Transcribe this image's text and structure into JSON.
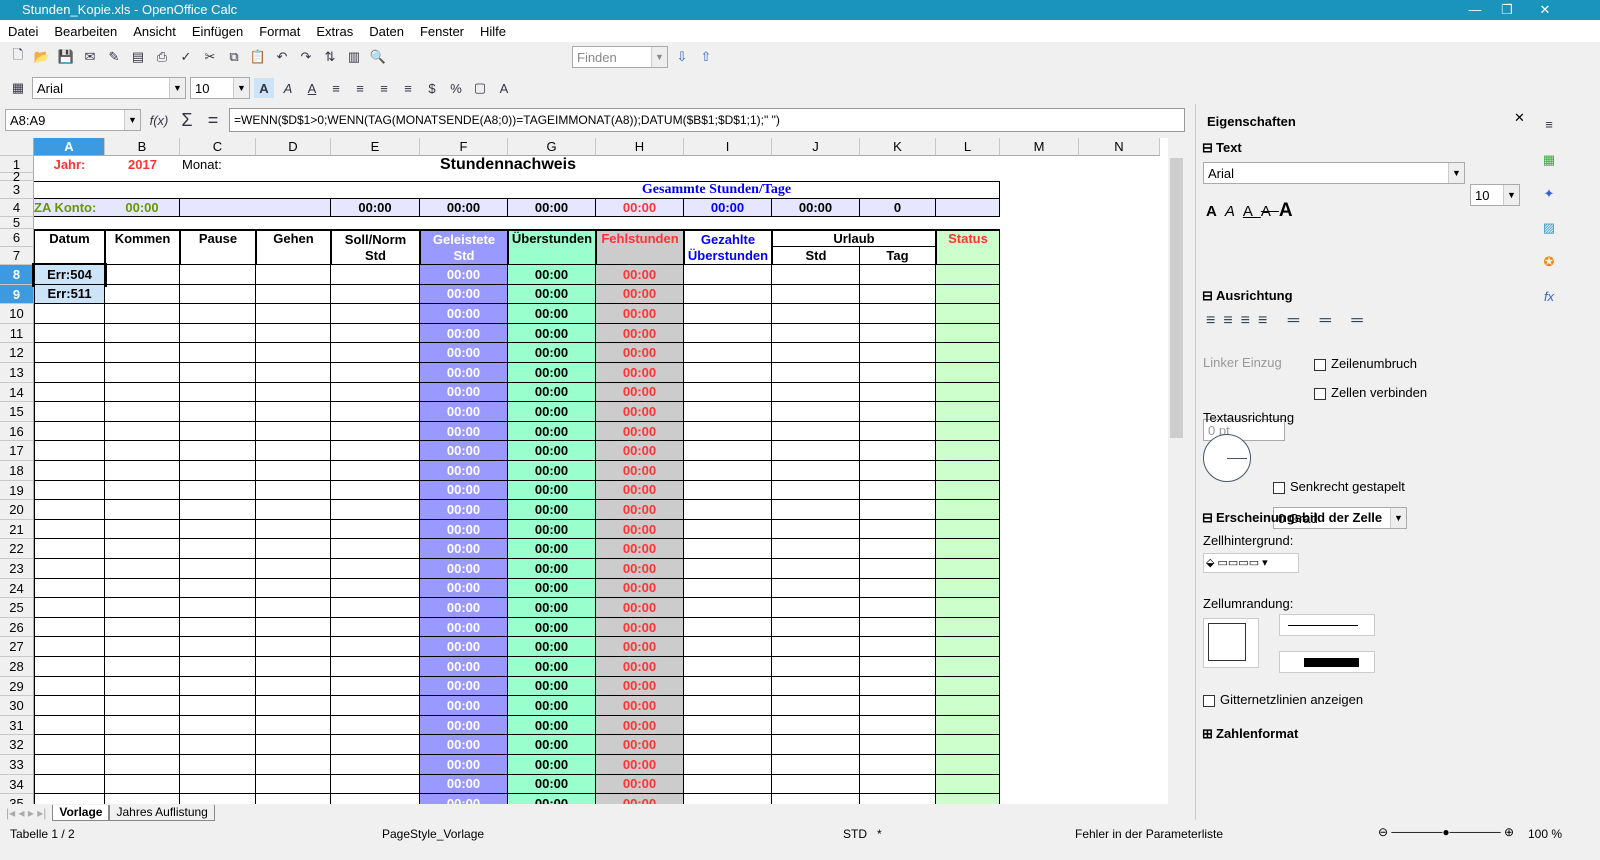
{
  "window": {
    "title": "Stunden_Kopie.xls - OpenOffice Calc",
    "min": "—",
    "max": "❐",
    "close": "✕"
  },
  "menu": [
    "Datei",
    "Bearbeiten",
    "Ansicht",
    "Einfügen",
    "Format",
    "Extras",
    "Daten",
    "Fenster",
    "Hilfe"
  ],
  "toolbar": {
    "find_placeholder": "Finden",
    "font": "Arial",
    "size": "10"
  },
  "formulabar": {
    "cellref": "A8:A9",
    "fx": "f(x)",
    "sum": "Σ",
    "eq": "=",
    "formula": "=WENN($D$1>0;WENN(TAG(MONATSENDE(A8;0))=TAGEIMMONAT(A8));DATUM($B$1;$D$1;1);\" \")"
  },
  "columns": [
    "A",
    "B",
    "C",
    "D",
    "E",
    "F",
    "G",
    "H",
    "I",
    "J",
    "K",
    "L",
    "M",
    "N"
  ],
  "sheet": {
    "r1": {
      "jahr_label": "Jahr:",
      "jahr": "2017",
      "monat_label": "Monat:",
      "title": "Stundennachweis"
    },
    "r3": {
      "gesamt": "Gesammte Stunden/Tage"
    },
    "r4": {
      "za_label": "ZA Konto:",
      "za": "00:00",
      "E": "00:00",
      "F": "00:00",
      "G": "00:00",
      "H": "00:00",
      "I": "00:00",
      "J": "00:00",
      "K": "0"
    },
    "headers": {
      "A": "Datum",
      "B": "Kommen",
      "C": "Pause",
      "D": "Gehen",
      "E1": "Soll/Norm",
      "E2": "Std",
      "F1": "Geleistete",
      "F2": "Std",
      "G": "Überstunden",
      "H": "Fehlstunden",
      "I1": "Gezahlte",
      "I2": "Überstunden",
      "J": "Urlaub",
      "J2": "Std",
      "K2": "Tag",
      "L": "Status"
    },
    "rows": [
      {
        "n": 8,
        "A": "Err:504",
        "F": "00:00",
        "G": "00:00",
        "H": "00:00"
      },
      {
        "n": 9,
        "A": "Err:511",
        "F": "00:00",
        "G": "00:00",
        "H": "00:00"
      },
      {
        "n": 10,
        "F": "00:00",
        "G": "00:00",
        "H": "00:00"
      },
      {
        "n": 11,
        "F": "00:00",
        "G": "00:00",
        "H": "00:00"
      },
      {
        "n": 12,
        "F": "00:00",
        "G": "00:00",
        "H": "00:00"
      },
      {
        "n": 13,
        "F": "00:00",
        "G": "00:00",
        "H": "00:00"
      },
      {
        "n": 14,
        "F": "00:00",
        "G": "00:00",
        "H": "00:00"
      },
      {
        "n": 15,
        "F": "00:00",
        "G": "00:00",
        "H": "00:00"
      },
      {
        "n": 16,
        "F": "00:00",
        "G": "00:00",
        "H": "00:00"
      },
      {
        "n": 17,
        "F": "00:00",
        "G": "00:00",
        "H": "00:00"
      },
      {
        "n": 18,
        "F": "00:00",
        "G": "00:00",
        "H": "00:00"
      },
      {
        "n": 19,
        "F": "00:00",
        "G": "00:00",
        "H": "00:00"
      },
      {
        "n": 20,
        "F": "00:00",
        "G": "00:00",
        "H": "00:00"
      },
      {
        "n": 21,
        "F": "00:00",
        "G": "00:00",
        "H": "00:00"
      },
      {
        "n": 22,
        "F": "00:00",
        "G": "00:00",
        "H": "00:00"
      },
      {
        "n": 23,
        "F": "00:00",
        "G": "00:00",
        "H": "00:00"
      },
      {
        "n": 24,
        "F": "00:00",
        "G": "00:00",
        "H": "00:00"
      },
      {
        "n": 25,
        "F": "00:00",
        "G": "00:00",
        "H": "00:00"
      },
      {
        "n": 26,
        "F": "00:00",
        "G": "00:00",
        "H": "00:00"
      },
      {
        "n": 27,
        "F": "00:00",
        "G": "00:00",
        "H": "00:00"
      },
      {
        "n": 28,
        "F": "00:00",
        "G": "00:00",
        "H": "00:00"
      },
      {
        "n": 29,
        "F": "00:00",
        "G": "00:00",
        "H": "00:00"
      },
      {
        "n": 30,
        "F": "00:00",
        "G": "00:00",
        "H": "00:00"
      },
      {
        "n": 31,
        "F": "00:00",
        "G": "00:00",
        "H": "00:00"
      },
      {
        "n": 32,
        "F": "00:00",
        "G": "00:00",
        "H": "00:00"
      },
      {
        "n": 33,
        "F": "00:00",
        "G": "00:00",
        "H": "00:00"
      },
      {
        "n": 34,
        "F": "00:00",
        "G": "00:00",
        "H": "00:00"
      },
      {
        "n": 35,
        "F": "00:00",
        "G": "00:00",
        "H": "00:00"
      }
    ]
  },
  "colors": {
    "F": "#9999ff",
    "G": "#99ffcc",
    "H": "#cccccc",
    "L": "#ccffcc",
    "r4": "#e6e6ff",
    "red": "#ff3333",
    "blue": "#0000ff",
    "olive": "#669900",
    "selection": "#cce4f7",
    "title": "#1a93bd"
  },
  "sheet_tabs": [
    "Vorlage",
    "Jahres Auflistung"
  ],
  "status": {
    "sheet": "Tabelle 1 / 2",
    "pagestyle": "PageStyle_Vorlage",
    "mode": "STD",
    "modified": "*",
    "message": "Fehler in der Parameterliste",
    "zoom": "100 %"
  },
  "sidebar": {
    "title": "Eigenschaften",
    "text_section": "Text",
    "font": "Arial",
    "size": "10",
    "align_section": "Ausrichtung",
    "indent_label": "Linker Einzug",
    "indent_value": "0 pt",
    "wrap": "Zeilenumbruch",
    "merge": "Zellen verbinden",
    "orientation_label": "Textausrichtung",
    "degree": "0 Grad",
    "stacked": "Senkrecht gestapelt",
    "appearance_section": "Erscheinungsbild der Zelle",
    "bg_label": "Zellhintergrund:",
    "border_label": "Zellumrandung:",
    "gridlines": "Gitternetzlinien anzeigen",
    "number_section": "Zahlenformat"
  }
}
